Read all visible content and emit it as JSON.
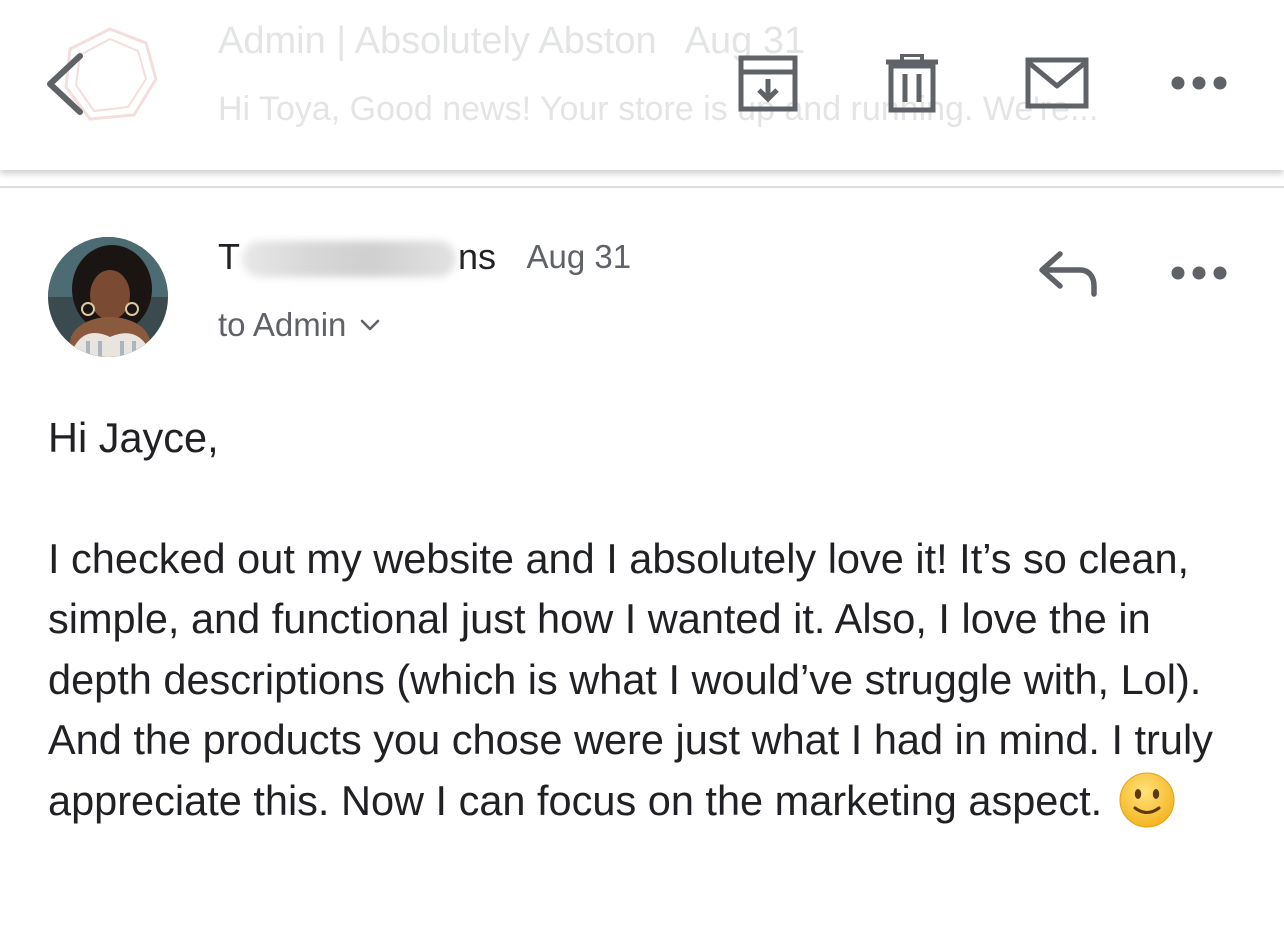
{
  "toolbar": {
    "back_icon": "chevron-left-icon",
    "archive_icon": "archive-icon",
    "trash_icon": "trash-icon",
    "mark_unread_icon": "mail-icon",
    "more_icon": "more-horizontal-icon",
    "icon_color": "#5f6368"
  },
  "background_preview": {
    "logo_icon": "store-logo-icon",
    "title": "Admin | Absolutely Abston",
    "date": "Aug 31",
    "snippet": "Hi Toya, Good news! Your store is up and running. We're..."
  },
  "message": {
    "sender_first": "T",
    "sender_last": "ns",
    "date": "Aug 31",
    "recipient": "to Admin",
    "reply_icon": "reply-icon",
    "more_icon": "more-horizontal-icon",
    "avatar_icon": "avatar-photo"
  },
  "body": {
    "greeting": "Hi Jayce,",
    "paragraph": "I checked out my website and I absolutely love it! It’s so clean, simple, and functional just how I wanted it. Also, I love the in depth descriptions (which is what I would’ve struggle with, Lol). And the products you chose were just what I had in mind. I truly appreciate this. Now I can focus on the marketing aspect.",
    "emoji_icon": "slightly-smiling-face-emoji"
  }
}
